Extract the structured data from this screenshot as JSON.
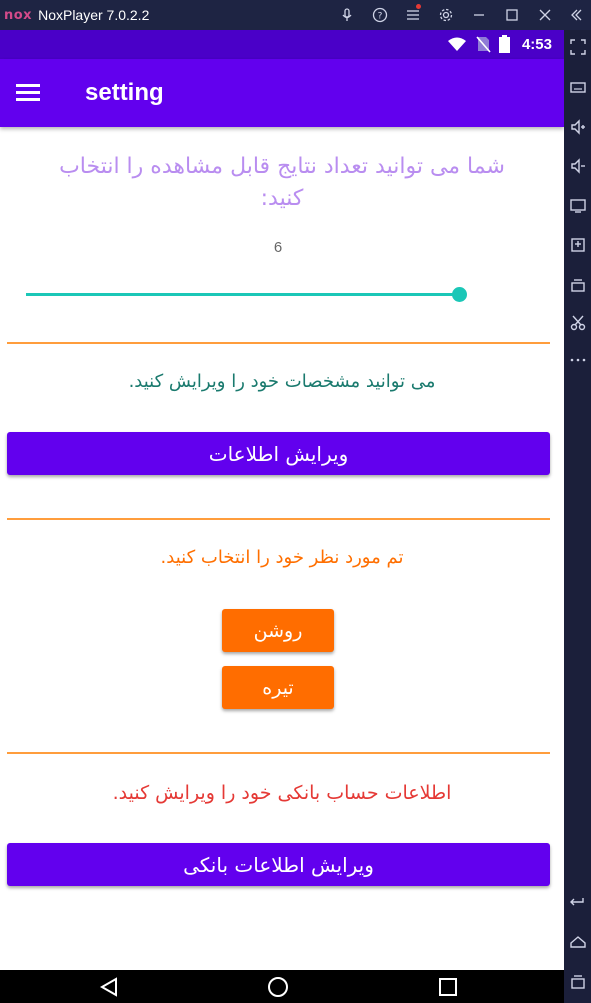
{
  "window": {
    "logo": "nox",
    "title": "NoxPlayer 7.0.2.2",
    "buttons": [
      "mic-icon",
      "help-icon",
      "menu-icon",
      "settings-icon",
      "minimize-icon",
      "maximize-icon",
      "close-icon",
      "collapse-icon"
    ]
  },
  "status_bar": {
    "time": "4:53",
    "icons": [
      "wifi-icon",
      "no-sim-icon",
      "battery-icon"
    ]
  },
  "app_bar": {
    "title": "setting",
    "menu_icon": "hamburger-icon"
  },
  "results_section": {
    "prompt": "شما می توانید تعداد نتایج قابل مشاهده را انتخاب کنید:",
    "slider_value": "6",
    "slider_fraction": 1.0,
    "accent_color": "#1bc7b7"
  },
  "profile_section": {
    "prompt": "می توانید مشخصات خود را ویرایش کنید.",
    "button_label": "ویرایش اطلاعات"
  },
  "theme_section": {
    "prompt": "تم مورد نظر خود را انتخاب کنید.",
    "light_label": "روشن",
    "dark_label": "تیره"
  },
  "bank_section": {
    "prompt": "اطلاعات حساب بانکی خود را ویرایش کنید.",
    "button_label": "ویرایش اطلاعات بانکی"
  },
  "colors": {
    "primary": "#6200ee",
    "status_bar": "#4a00c8",
    "orange": "#ff6d00",
    "divider": "#ff9d3c"
  },
  "nav_bar": [
    "back-icon",
    "home-icon",
    "recents-icon"
  ]
}
